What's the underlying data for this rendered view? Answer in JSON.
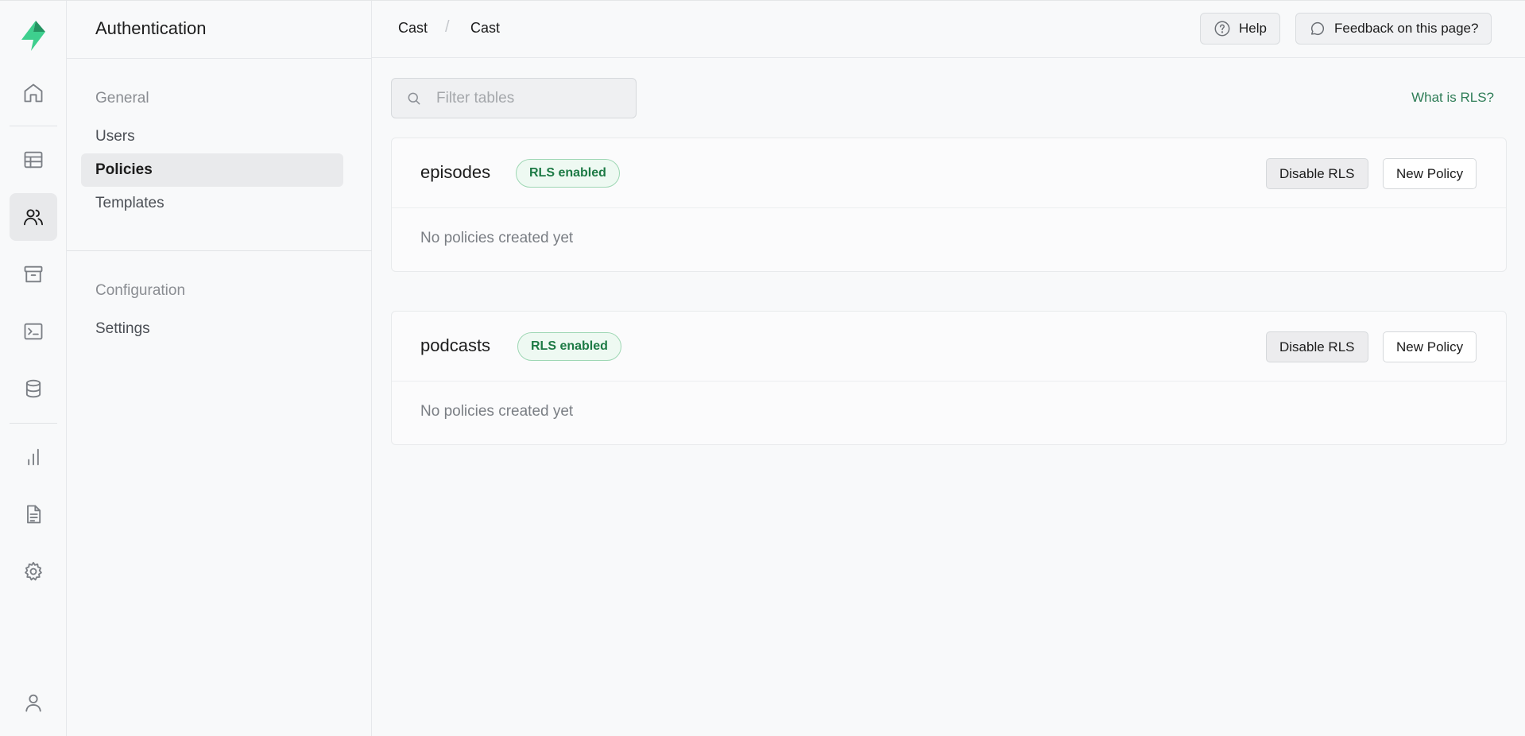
{
  "rail": {
    "items": [
      {
        "icon": "home-icon"
      },
      {
        "icon": "table-editor-icon"
      },
      {
        "icon": "users-icon"
      },
      {
        "icon": "archive-icon"
      },
      {
        "icon": "terminal-icon"
      },
      {
        "icon": "database-icon"
      },
      {
        "icon": "bar-chart-icon"
      },
      {
        "icon": "document-icon"
      },
      {
        "icon": "gear-icon"
      }
    ],
    "accent": "#3ecf8e"
  },
  "menu": {
    "title": "Authentication",
    "groups": [
      {
        "title": "General",
        "items": [
          "Users",
          "Policies",
          "Templates"
        ]
      },
      {
        "title": "Configuration",
        "items": [
          "Settings"
        ]
      }
    ],
    "active_item": "Policies"
  },
  "topbar": {
    "breadcrumb": [
      "Cast",
      "Cast"
    ],
    "separator": "/",
    "help_label": "Help",
    "feedback_label": "Feedback on this page?"
  },
  "main": {
    "search": {
      "placeholder": "Filter tables",
      "value": ""
    },
    "rls_link": "What is RLS?",
    "tables": [
      {
        "name": "episodes",
        "badge": "RLS enabled",
        "disable_label": "Disable RLS",
        "new_policy_label": "New Policy",
        "empty_text": "No policies created yet"
      },
      {
        "name": "podcasts",
        "badge": "RLS enabled",
        "disable_label": "Disable RLS",
        "new_policy_label": "New Policy",
        "empty_text": "No policies created yet"
      }
    ]
  },
  "colors": {
    "badge_green": "#1d7a45",
    "link_green": "#2f7d57"
  }
}
